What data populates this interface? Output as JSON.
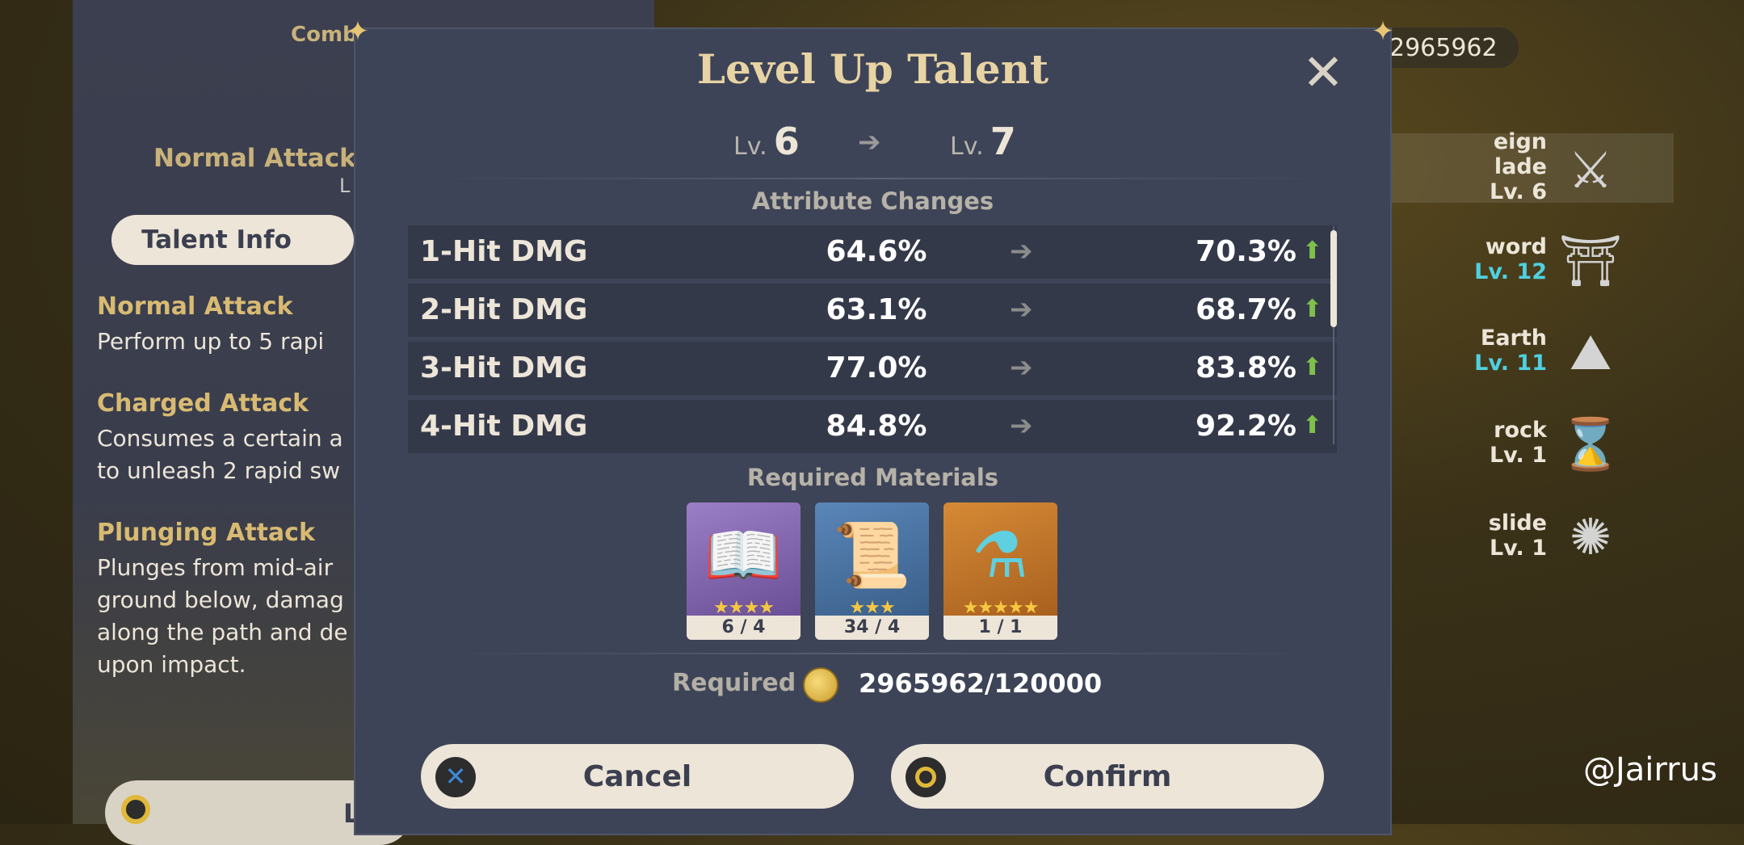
{
  "background": {
    "combat_title": "Comb",
    "talent_name": "Normal Attack: I",
    "talent_lv": "L",
    "talent_info_tab": "Talent Info",
    "sections": [
      {
        "heading": "Normal Attack",
        "lines": [
          "Perform up to 5 rapi"
        ]
      },
      {
        "heading": "Charged Attack",
        "lines": [
          "Consumes a certain a",
          "to unleash 2 rapid sw"
        ]
      },
      {
        "heading": "Plunging Attack",
        "lines": [
          "Plunges from mid-air",
          "ground below, damag",
          "along the path and de",
          "upon impact."
        ]
      }
    ],
    "level_button_label": "Le",
    "mora_total": "2965962",
    "right_talents": [
      {
        "name_lines": [
          "eign",
          "lade"
        ],
        "level": "Lv. 6",
        "level_color": "white",
        "icon": "crossed-swords-icon"
      },
      {
        "name_lines": [
          "word"
        ],
        "level": "Lv. 12",
        "level_color": "cyan",
        "icon": "gate-icon"
      },
      {
        "name_lines": [
          "Earth"
        ],
        "level": "Lv. 11",
        "level_color": "cyan",
        "icon": "rock-icon"
      },
      {
        "name_lines": [
          "rock"
        ],
        "level": "Lv. 1",
        "level_color": "white",
        "icon": "hourglass-icon"
      },
      {
        "name_lines": [
          "slide"
        ],
        "level": "Lv. 1",
        "level_color": "white",
        "icon": "sun-rune-icon"
      }
    ],
    "watermark": "@Jairrus"
  },
  "dialog": {
    "title": "Level Up Talent",
    "from_prefix": "Lv.",
    "from_level": "6",
    "to_prefix": "Lv.",
    "to_level": "7",
    "attribute_changes_title": "Attribute Changes",
    "attributes": [
      {
        "name": "1-Hit DMG",
        "current": "64.6%",
        "next": "70.3%"
      },
      {
        "name": "2-Hit DMG",
        "current": "63.1%",
        "next": "68.7%"
      },
      {
        "name": "3-Hit DMG",
        "current": "77.0%",
        "next": "83.8%"
      },
      {
        "name": "4-Hit DMG",
        "current": "84.8%",
        "next": "92.2%"
      }
    ],
    "required_materials_title": "Required Materials",
    "materials": [
      {
        "name": "talent-book-icon",
        "stars": "★★★★",
        "count": "6 / 4",
        "bg": "#8a6fb3"
      },
      {
        "name": "scroll-icon",
        "stars": "★★★",
        "count": "34 / 4",
        "bg": "#4f78a8"
      },
      {
        "name": "crown-flask-icon",
        "stars": "★★★★★",
        "count": "1 / 1",
        "bg": "#c27a2e"
      }
    ],
    "required_label": "Required",
    "required_mora": "2965962/120000",
    "cancel_label": "Cancel",
    "confirm_label": "Confirm"
  }
}
